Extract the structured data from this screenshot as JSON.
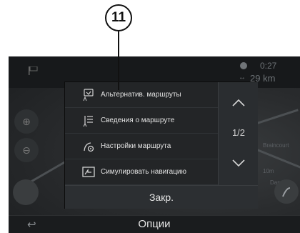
{
  "callout": {
    "number": "11"
  },
  "topbar": {
    "eta": "0:27",
    "distance": "29 km"
  },
  "map": {
    "labels": [
      "Braincourt",
      "Damart",
      "10m"
    ]
  },
  "popup": {
    "items": [
      {
        "label": "Альтернатив. маршруты",
        "icon": "alternative-routes-icon"
      },
      {
        "label": "Сведения о маршруте",
        "icon": "route-info-icon"
      },
      {
        "label": "Настройки маршрута",
        "icon": "route-settings-icon"
      },
      {
        "label": "Симулировать навигацию",
        "icon": "simulate-navigation-icon"
      }
    ],
    "pager": {
      "page": "1/2"
    },
    "close_label": "Закр."
  },
  "bottombar": {
    "title": "Опции"
  },
  "colors": {
    "screen_bg": "#1d1f21",
    "popup_bg": "#232527",
    "text": "#e2e2e2"
  }
}
